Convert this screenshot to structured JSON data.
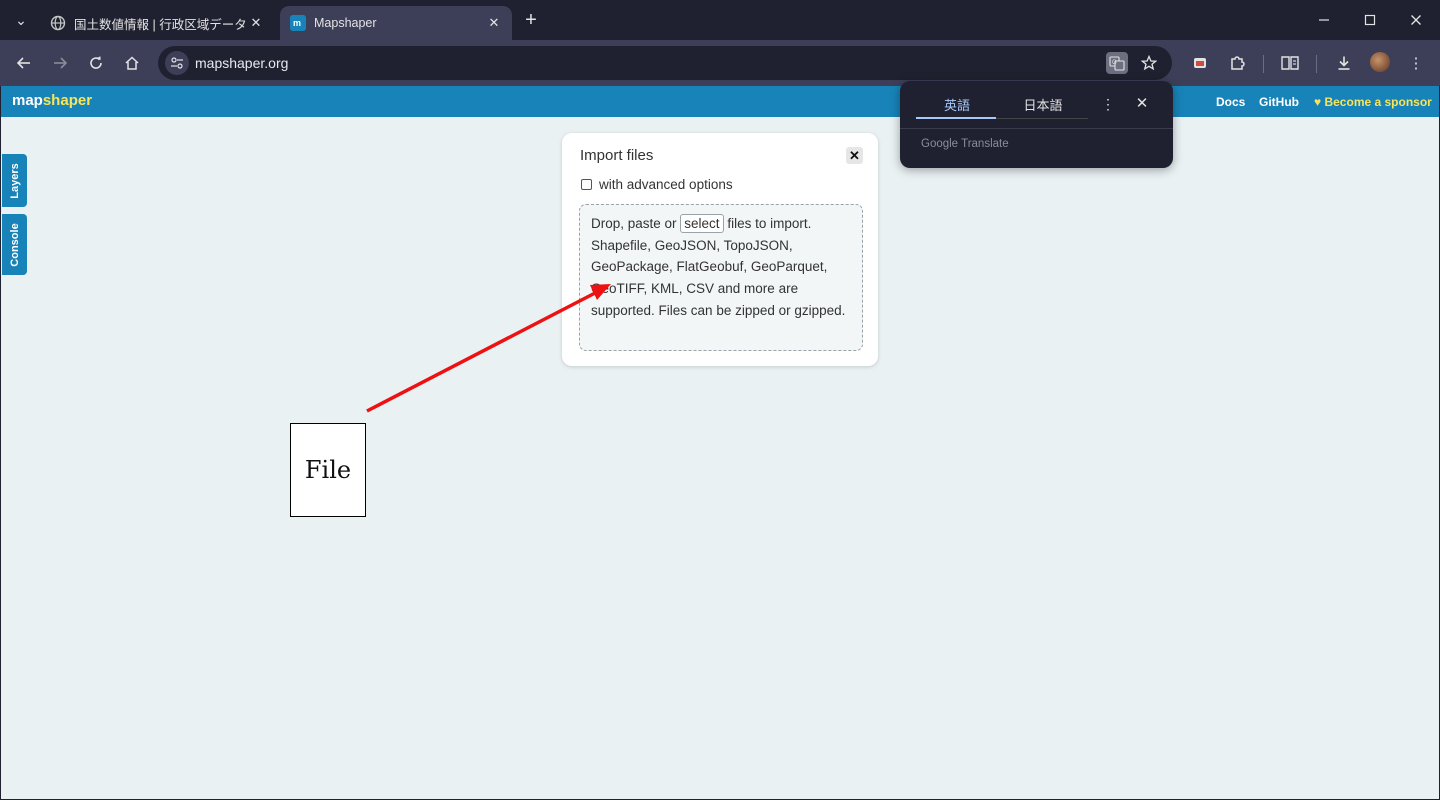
{
  "browser": {
    "tabs": [
      {
        "title": "国土数値情報 | 行政区域データ",
        "favicon": "globe-icon",
        "active": false
      },
      {
        "title": "Mapshaper",
        "favicon": "mapshaper-icon",
        "active": true
      }
    ],
    "url": "mapshaper.org",
    "accent": "#a8c7fa"
  },
  "app": {
    "logo_map": "map",
    "logo_shaper": "shaper",
    "nav": {
      "docs": "Docs",
      "github": "GitHub",
      "sponsor": "Become a sponsor"
    },
    "side_tabs": {
      "layers": "Layers",
      "console": "Console"
    },
    "brand_color": "#1883b8",
    "accent_yellow": "#f6e55c"
  },
  "import_dialog": {
    "title": "Import files",
    "advanced_label": "with advanced options",
    "advanced_checked": false,
    "drop_text_before": "Drop, paste or ",
    "select_label": "select",
    "drop_text_after": " files to import. Shapefile, GeoJSON, TopoJSON, GeoPackage, FlatGeobuf, GeoParquet, GeoTIFF, KML, CSV and more are supported. Files can be zipped or gzipped."
  },
  "annotation": {
    "file_label": "File",
    "arrow_color": "#ee1111"
  },
  "translate_popup": {
    "source_lang": "英語",
    "target_lang": "日本語",
    "brand_google": "Google",
    "brand_translate": "Translate"
  }
}
